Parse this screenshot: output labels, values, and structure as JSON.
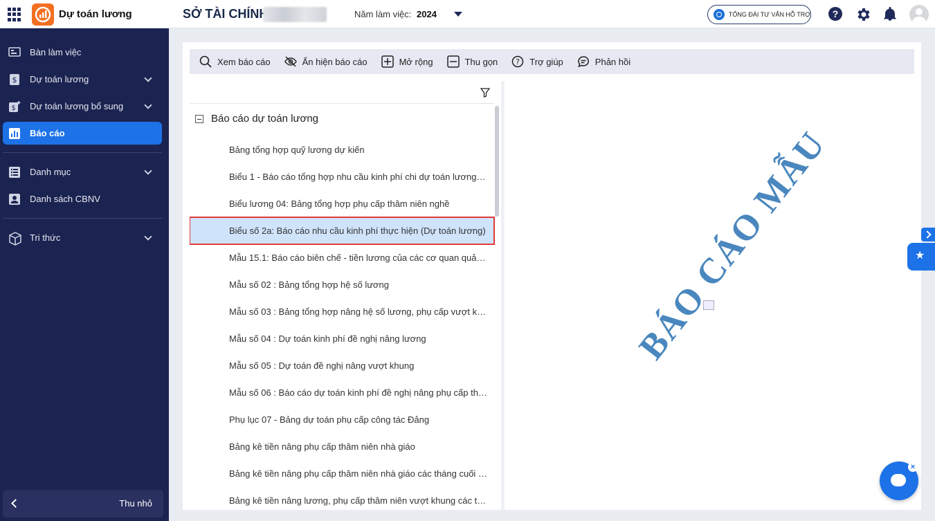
{
  "header": {
    "app_title": "Dự toán lương",
    "org_title": "SỞ TÀI CHÍNH",
    "year_label": "Năm làm việc:",
    "year_value": "2024",
    "hotline_label": "TỔNG ĐÀI TƯ VẤN HỖ TRỢ",
    "help_glyph": "?"
  },
  "sidebar": {
    "items": [
      {
        "label": "Bàn làm việc",
        "icon": "dashboard-icon"
      },
      {
        "label": "Dự toán lương",
        "icon": "salary-icon"
      },
      {
        "label": "Dự toán lương bổ sung",
        "icon": "salary-plus-icon"
      },
      {
        "label": "Báo cáo",
        "icon": "chart-icon"
      },
      {
        "label": "Danh mục",
        "icon": "list-icon"
      },
      {
        "label": "Danh sách CBNV",
        "icon": "person-card-icon"
      },
      {
        "label": "Tri thức",
        "icon": "cube-icon"
      }
    ],
    "collapse_label": "Thu nhỏ"
  },
  "toolbar": {
    "view": "Xem báo cáo",
    "toggle": "Ẩn hiện báo cáo",
    "expand": "Mở rộng",
    "collapse": "Thu gọn",
    "help": "Trợ giúp",
    "feedback": "Phản hồi"
  },
  "tree": {
    "group": "Báo cáo dự toán lương",
    "items": [
      "Bảng tổng hợp quỹ lương dự kiến",
      "Biểu 1 - Báo cáo tổng hợp nhu cầu kinh phí chi dự toán lương ch...",
      "Biểu lương 04: Bảng tổng hợp phụ cấp thâm niên nghề",
      "Biểu số 2a: Báo cáo nhu cầu kinh phí thực hiện (Dự toán lương)",
      "Mẫu 15.1: Báo cáo biên chế - tiền lương của các cơ quan quản l...",
      "Mẫu số 02 : Bảng tổng hợp hệ số lương",
      "Mẫu số 03 : Bảng tổng hợp nâng hệ số lương, phụ cấp vượt khu...",
      "Mẫu số 04 : Dự toán kinh phí đề nghị nâng lương",
      "Mẫu số 05 : Dự toán đề nghị nâng vượt khung",
      "Mẫu số 06 : Báo cáo dự toán kinh phí đề nghị nâng phụ cấp thâ...",
      "Phụ lục 07 - Bảng dự toán phụ cấp công tác Đảng",
      "Bảng kê tiền nâng phụ cấp thâm niên nhà giáo",
      "Bảng kê tiền nâng phụ cấp thâm niên nhà giáo các tháng cuối n...",
      "Bảng kê tiền nâng lương, phụ cấp thâm niên vượt khung các thá..."
    ],
    "selected_index": 3
  },
  "preview": {
    "watermark": "BÁO CÁO MẪU"
  },
  "chat": {
    "close_glyph": "×"
  },
  "colors": {
    "sidebar_bg": "#1b2350",
    "accent": "#1d72e8",
    "logo": "#f37021",
    "selected_row": "#cfe3fb",
    "selected_border": "#e03a3a",
    "watermark": "#4a87be"
  }
}
